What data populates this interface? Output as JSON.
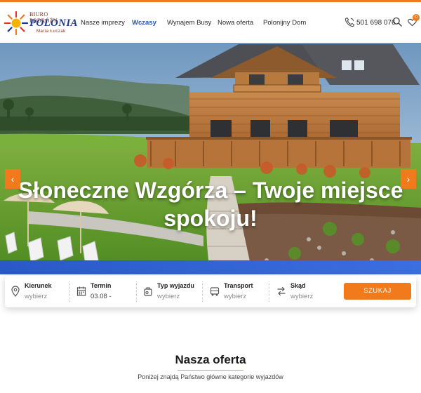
{
  "brand": {
    "line1": "BIURO PODRÓŻY",
    "line2": "POLONIA",
    "line3": "Maria Łuczak"
  },
  "nav": {
    "items": [
      {
        "label": "Nasze imprezy",
        "active": false
      },
      {
        "label": "Wczasy",
        "active": true
      },
      {
        "label": "Wynajem Busy",
        "active": false
      },
      {
        "label": "Nowa oferta",
        "active": false
      },
      {
        "label": "Polonijny Dom",
        "active": false
      }
    ]
  },
  "header": {
    "phone": "501 698 076",
    "favorites_count": "0"
  },
  "hero": {
    "title": "Słoneczne Wzgórza – Twoje miejsce spokoju!",
    "prev_label": "‹",
    "next_label": "›"
  },
  "search": {
    "fields": [
      {
        "label": "Kierunek",
        "value": "wybierz",
        "icon": "location-pin-icon"
      },
      {
        "label": "Termin",
        "value": "03.08 -",
        "icon": "calendar-icon"
      },
      {
        "label": "Typ wyjazdu",
        "value": "wybierz",
        "icon": "suitcase-icon"
      },
      {
        "label": "Transport",
        "value": "wybierz",
        "icon": "bus-icon"
      },
      {
        "label": "Skąd",
        "value": "wybierz",
        "icon": "route-arrows-icon"
      }
    ],
    "button_label": "SZUKAJ"
  },
  "offer": {
    "title": "Nasza oferta",
    "subtitle": "Poniżej znajdą Państwo główne kategorie wyjazdów"
  },
  "colors": {
    "accent": "#f07a1c",
    "nav_active": "#1e57b5",
    "brand_blue": "#1c3a8a"
  }
}
